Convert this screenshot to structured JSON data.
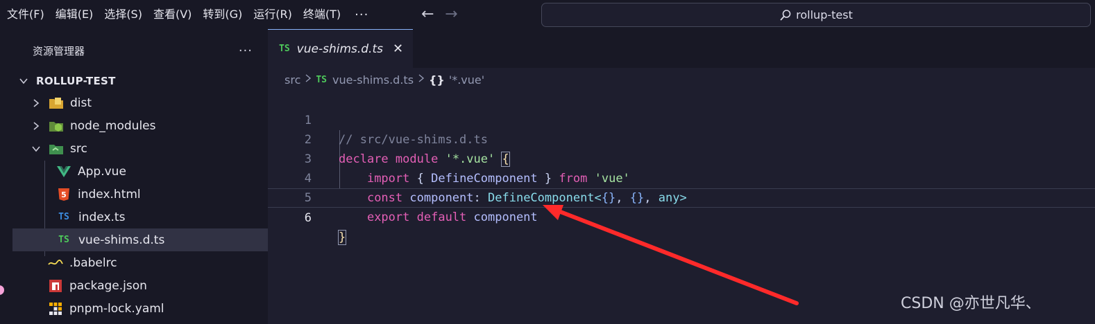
{
  "menu": [
    "文件(F)",
    "编辑(E)",
    "选择(S)",
    "查看(V)",
    "转到(G)",
    "运行(R)",
    "终端(T)"
  ],
  "menu_more": "···",
  "search": {
    "text": "rollup-test"
  },
  "sidebar": {
    "title": "资源管理器",
    "more": "···",
    "root": "ROLLUP-TEST",
    "items": [
      {
        "label": "dist",
        "icon": "folder-dist-icon"
      },
      {
        "label": "node_modules",
        "icon": "folder-node-icon"
      },
      {
        "label": "src",
        "icon": "folder-src-icon"
      },
      {
        "label": "App.vue",
        "icon": "vue-icon"
      },
      {
        "label": "index.html",
        "icon": "html5-icon"
      },
      {
        "label": "index.ts",
        "icon": "ts-icon",
        "badge": "TS"
      },
      {
        "label": "vue-shims.d.ts",
        "icon": "ts-icon",
        "badge": "TS"
      },
      {
        "label": ".babelrc",
        "icon": "babel-icon"
      },
      {
        "label": "package.json",
        "icon": "npm-icon"
      },
      {
        "label": "pnpm-lock.yaml",
        "icon": "pnpm-icon"
      }
    ]
  },
  "tab": {
    "badge": "TS",
    "label": "vue-shims.d.ts",
    "close": "✕"
  },
  "breadcrumb": {
    "folder": "src",
    "badge": "TS",
    "file": "vue-shims.d.ts",
    "braces": "{}",
    "symbol": "'*.vue'"
  },
  "code": {
    "line_numbers": [
      "1",
      "2",
      "3",
      "4",
      "5",
      "6"
    ],
    "l1": {
      "comment": "// src/vue-shims.d.ts"
    },
    "l2": {
      "kw1": "declare",
      "kw2": "module",
      "str": "'*.vue'",
      "brace": "{"
    },
    "l3": {
      "kw": "import",
      "open": "{",
      "name": "DefineComponent",
      "close": "}",
      "from": "from",
      "str": "'vue'"
    },
    "l4": {
      "kw": "const",
      "var": "component",
      "colon": ":",
      "type": "DefineComponent",
      "lt": "<",
      "o1": "{",
      "c1": "}",
      "comma1": ",",
      "o2": "{",
      "c2": "}",
      "comma2": ",",
      "any": "any",
      "gt": ">"
    },
    "l5": {
      "kw1": "export",
      "kw2": "default",
      "var": "component"
    },
    "l6": {
      "brace": "}"
    }
  },
  "colors": {
    "accent_arrow": "#ff2a2a",
    "ts_blue": "#3178c6",
    "ts_green": "#4ec95b"
  },
  "watermark": "CSDN @亦世凡华、"
}
